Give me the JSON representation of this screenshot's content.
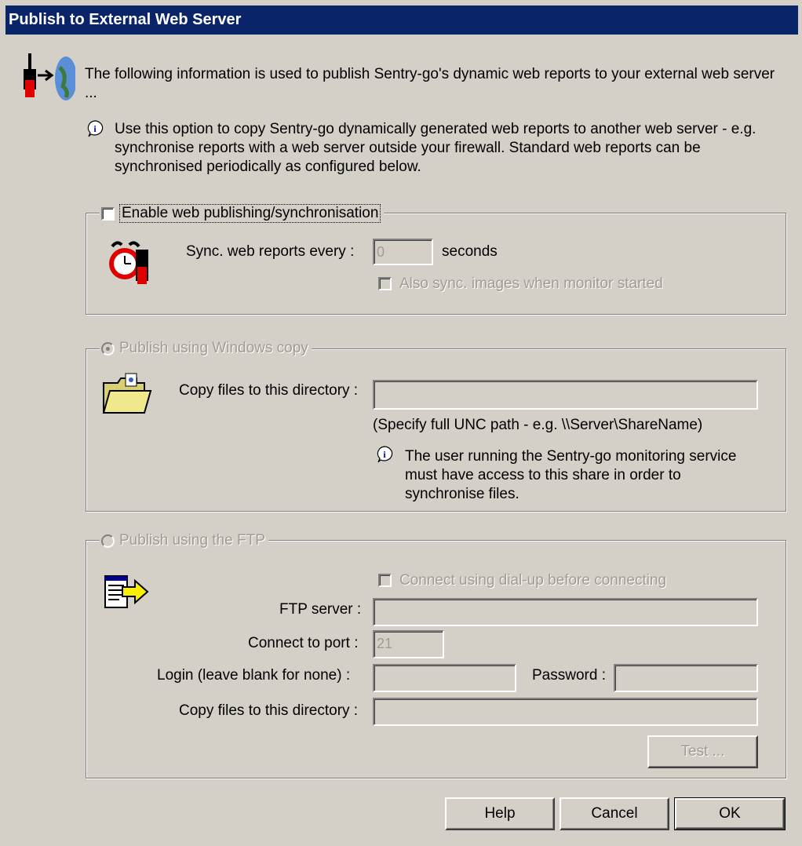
{
  "window": {
    "title": "Publish to External Web Server"
  },
  "header": {
    "description": "The following information is used to publish Sentry-go's dynamic web reports to your external web server ..."
  },
  "info": {
    "text": "Use this option to copy Sentry-go dynamically generated web reports to another web server - e.g. synchronise reports with a web server outside your firewall. Standard web reports can be synchronised periodically as configured below."
  },
  "sync_group": {
    "legend": "Enable web publishing/synchronisation",
    "enabled": false,
    "sync_label": "Sync. web reports every :",
    "sync_value": "0",
    "units": "seconds",
    "images_label": "Also sync. images when monitor started"
  },
  "windows_group": {
    "legend": "Publish using Windows copy",
    "selected": true,
    "dir_label": "Copy files to this directory :",
    "dir_value": "",
    "hint": "(Specify full UNC path - e.g. \\\\Server\\ShareName)",
    "note": "The user running the Sentry-go monitoring service must have access to this share in order to synchronise files."
  },
  "ftp_group": {
    "legend": "Publish using the FTP",
    "selected": false,
    "dialup_label": "Connect using dial-up before connecting",
    "server_label": "FTP server :",
    "server_value": "",
    "port_label": "Connect to port :",
    "port_value": "21",
    "login_label": "Login (leave blank for none) :",
    "login_value": "",
    "password_label": "Password :",
    "password_value": "",
    "dir_label": "Copy files to this directory :",
    "dir_value": "",
    "test_label": "Test ..."
  },
  "buttons": {
    "help": "Help",
    "cancel": "Cancel",
    "ok": "OK"
  },
  "icons": {
    "header": "publish-globe-icon",
    "info": "info-bubble-icon",
    "clock": "alarm-clock-icon",
    "folder": "folder-icon",
    "ftp": "ftp-transfer-icon"
  }
}
